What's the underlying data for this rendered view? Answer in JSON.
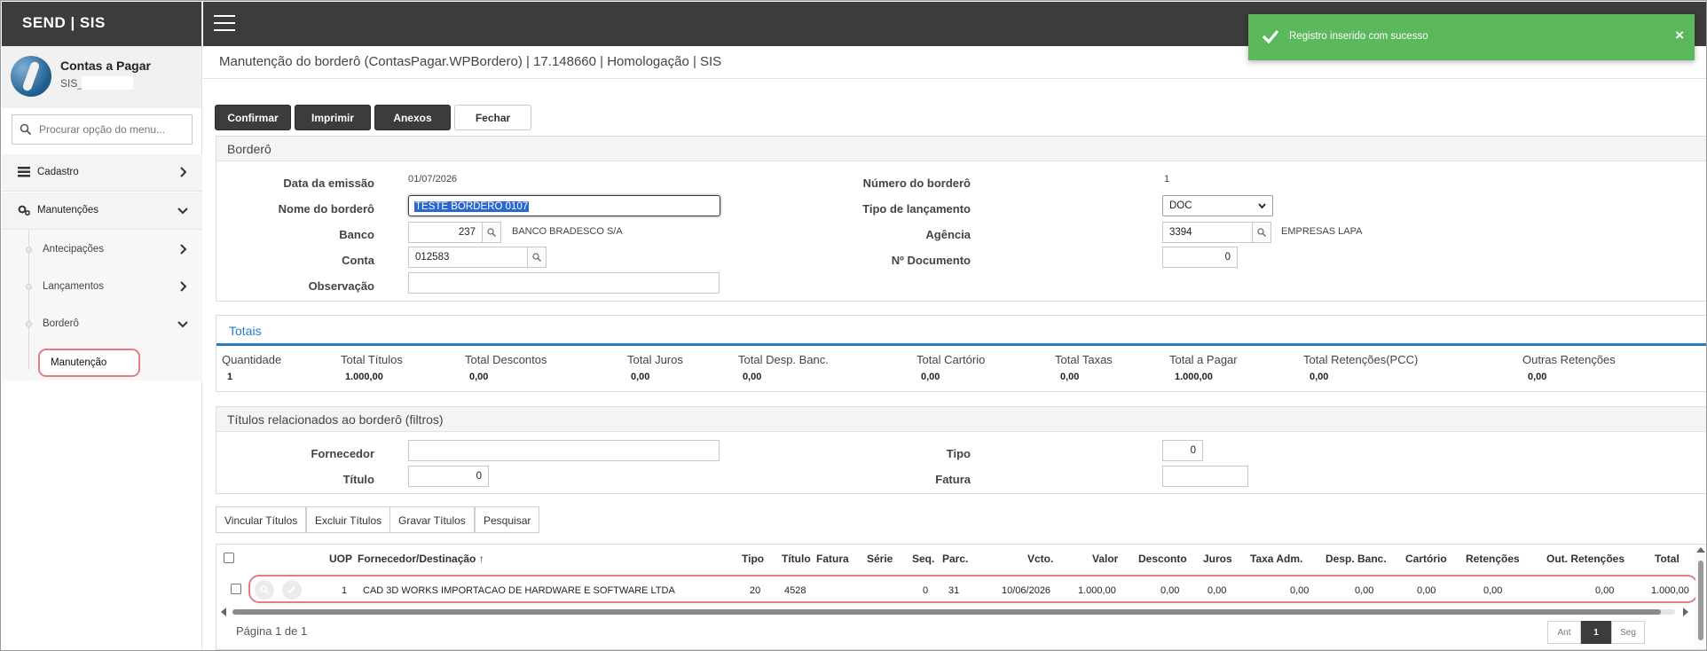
{
  "app": {
    "brand": "SEND | SIS"
  },
  "profile": {
    "name": "Contas a Pagar",
    "sub": "SIS_"
  },
  "search": {
    "placeholder": "Procurar opção do menu..."
  },
  "menu": {
    "cadastro": "Cadastro",
    "manutencoes": "Manutenções",
    "antecipacoes": "Antecipações",
    "lancamentos": "Lançamentos",
    "bordero": "Borderô",
    "manutencao": "Manutenção"
  },
  "toast": {
    "message": "Registro inserido com sucesso",
    "close": "×"
  },
  "page": {
    "title": "Manutenção do borderô (ContasPagar.WPBordero) | 17.148660 | Homologação | SIS"
  },
  "toolbar": {
    "confirmar": "Confirmar",
    "imprimir": "Imprimir",
    "anexos": "Anexos",
    "fechar": "Fechar"
  },
  "bordero": {
    "section": "Borderô",
    "data_emissao_label": "Data da emissão",
    "data_emissao": "01/07/2026",
    "nome_label": "Nome do borderô",
    "nome": "TESTE BORDERO 0107",
    "banco_label": "Banco",
    "banco_codigo": "237",
    "banco_nome": "BANCO BRADESCO S/A",
    "conta_label": "Conta",
    "conta": "012583",
    "observacao_label": "Observação",
    "observacao": "",
    "numero_label": "Número do borderô",
    "numero": "1",
    "tipo_lanc_label": "Tipo de lançamento",
    "tipo_lanc": "DOC",
    "agencia_label": "Agência",
    "agencia": "3394",
    "agencia_nome": "EMPRESAS LAPA",
    "documento_label": "Nº Documento",
    "documento": "0"
  },
  "totais": {
    "section": "Totais",
    "labels": [
      "Quantidade",
      "Total Títulos",
      "Total Descontos",
      "Total Juros",
      "Total Desp. Banc.",
      "Total Cartório",
      "Total Taxas",
      "Total a Pagar",
      "Total Retenções(PCC)",
      "Outras Retenções"
    ],
    "values": [
      "1",
      "1.000,00",
      "0,00",
      "0,00",
      "0,00",
      "0,00",
      "0,00",
      "1.000,00",
      "0,00",
      "0,00"
    ]
  },
  "filtros": {
    "section": "Títulos relacionados ao borderô (filtros)",
    "fornecedor_label": "Fornecedor",
    "fornecedor": "",
    "titulo_label": "Título",
    "titulo": "0",
    "tipo_label": "Tipo",
    "tipo": "0",
    "fatura_label": "Fatura",
    "fatura": ""
  },
  "tabs": [
    "Vincular Títulos",
    "Excluir Títulos",
    "Gravar Títulos",
    "Pesquisar"
  ],
  "grid": {
    "headers": [
      "UOP",
      "Fornecedor/Destinação",
      "Tipo",
      "Título",
      "Fatura",
      "Série",
      "Seq.",
      "Parc.",
      "Vcto.",
      "Valor",
      "Desconto",
      "Juros",
      "Taxa Adm.",
      "Desp. Banc.",
      "Cartório",
      "Retenções",
      "Out. Retenções",
      "Total"
    ],
    "sort_indicator": "↑",
    "rows": [
      [
        "1",
        "CAD 3D WORKS IMPORTACAO DE HARDWARE E SOFTWARE LTDA",
        "20",
        "4528",
        "",
        "",
        "0",
        "31",
        "10/06/2026",
        "1.000,00",
        "0,00",
        "0,00",
        "0,00",
        "0,00",
        "0,00",
        "0,00",
        "0,00",
        "1.000,00"
      ]
    ],
    "page_info": "Página 1 de 1",
    "pager": {
      "prev": "Ant",
      "current": "1",
      "next": "Seg"
    }
  },
  "colors": {
    "dark": "#3c3c3c",
    "accent": "#2b7bbf",
    "success": "#5cb85c",
    "highlight": "#e27d86",
    "selection": "#2a67d0"
  }
}
